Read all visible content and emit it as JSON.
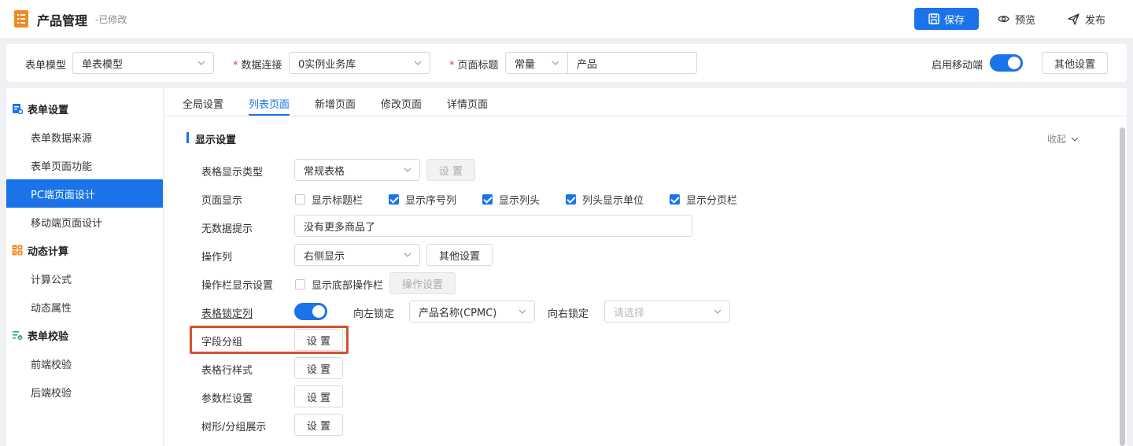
{
  "header": {
    "title": "产品管理",
    "status": "-已修改",
    "save_label": "保存",
    "preview_label": "预览",
    "publish_label": "发布"
  },
  "config": {
    "form_model_label": "表单模型",
    "form_model_value": "单表模型",
    "data_conn_label": "数据连接",
    "data_conn_value": "0实例业务库",
    "page_title_label": "页面标题",
    "page_title_type": "常量",
    "page_title_value": "产品",
    "mobile_label": "启用移动端",
    "mobile_enabled": true,
    "other_settings_label": "其他设置"
  },
  "sidebar": {
    "groups": [
      {
        "label": "表单设置",
        "icon": "form-settings-icon",
        "items": [
          "表单数据来源",
          "表单页面功能",
          "PC端页面设计",
          "移动端页面设计"
        ]
      },
      {
        "label": "动态计算",
        "icon": "calculator-icon",
        "items": [
          "计算公式",
          "动态属性"
        ]
      },
      {
        "label": "表单校验",
        "icon": "validation-icon",
        "items": [
          "前端校验",
          "后端校验"
        ]
      }
    ],
    "active_item": "PC端页面设计"
  },
  "tabs": [
    "全局设置",
    "列表页面",
    "新增页面",
    "修改页面",
    "详情页面"
  ],
  "active_tab": "列表页面",
  "section": {
    "title": "显示设置",
    "collapse_label": "收起"
  },
  "rows": {
    "table_type_label": "表格显示类型",
    "table_type_value": "常规表格",
    "table_type_btn": "设 置",
    "page_display_label": "页面显示",
    "page_display_options": [
      {
        "label": "显示标题栏",
        "checked": false
      },
      {
        "label": "显示序号列",
        "checked": true
      },
      {
        "label": "显示列头",
        "checked": true
      },
      {
        "label": "列头显示单位",
        "checked": true
      },
      {
        "label": "显示分页栏",
        "checked": true
      }
    ],
    "no_data_label": "无数据提示",
    "no_data_value": "没有更多商品了",
    "op_col_label": "操作列",
    "op_col_value": "右侧显示",
    "op_col_btn": "其他设置",
    "op_bar_label": "操作栏显示设置",
    "op_bar_checkbox": "显示底部操作栏",
    "op_bar_btn": "操作设置",
    "lock_label": "表格锁定列",
    "lock_enabled": true,
    "lock_left_label": "向左锁定",
    "lock_left_value": "产品名称(CPMC)",
    "lock_right_label": "向右锁定",
    "lock_right_placeholder": "请选择",
    "field_group_label": "字段分组",
    "row_style_label": "表格行样式",
    "param_bar_label": "参数栏设置",
    "tree_label": "树形/分组展示",
    "set_btn": "设 置"
  },
  "colors": {
    "primary": "#1a73e8",
    "highlight": "#d0522e",
    "logo": "#f08a24"
  }
}
